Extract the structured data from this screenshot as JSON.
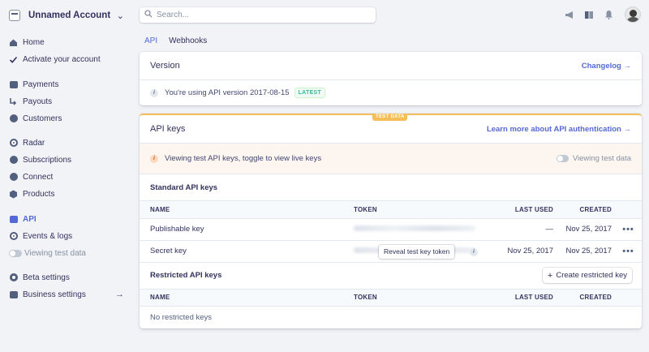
{
  "account": {
    "name": "Unnamed Account"
  },
  "search": {
    "placeholder": "Search..."
  },
  "nav": [
    {
      "label": "Home",
      "icon": "house-icon"
    },
    {
      "label": "Activate your account",
      "icon": "check-icon"
    },
    {
      "label": "Payments",
      "icon": "payments-icon"
    },
    {
      "label": "Payouts",
      "icon": "payouts-icon"
    },
    {
      "label": "Customers",
      "icon": "customers-icon"
    },
    {
      "label": "Radar",
      "icon": "radar-icon"
    },
    {
      "label": "Subscriptions",
      "icon": "subscriptions-icon"
    },
    {
      "label": "Connect",
      "icon": "connect-icon"
    },
    {
      "label": "Products",
      "icon": "products-icon"
    },
    {
      "label": "API",
      "icon": "api-icon"
    },
    {
      "label": "Events & logs",
      "icon": "events-icon"
    },
    {
      "label": "Viewing test data",
      "icon": "toggle-icon"
    },
    {
      "label": "Beta settings",
      "icon": "gear-icon"
    },
    {
      "label": "Business settings",
      "icon": "business-icon"
    }
  ],
  "tabs": [
    "API",
    "Webhooks"
  ],
  "version_card": {
    "title": "Version",
    "link": "Changelog →",
    "message": "You're using API version 2017-08-15",
    "badge": "LATEST"
  },
  "keys_card": {
    "badge": "TEST DATA",
    "title": "API keys",
    "link": "Learn more about API authentication →",
    "banner": "Viewing test API keys, toggle to view live keys",
    "toggle_label": "Viewing test data",
    "standard_title": "Standard API keys",
    "columns": [
      "NAME",
      "TOKEN",
      "LAST USED",
      "CREATED"
    ],
    "standard_rows": [
      {
        "name": "Publishable key",
        "last_used": "—",
        "created": "Nov 25, 2017"
      },
      {
        "name": "Secret key",
        "last_used": "Nov 25, 2017",
        "created": "Nov 25, 2017",
        "reveal": "Reveal test key token"
      }
    ],
    "restricted_title": "Restricted API keys",
    "create_button": "Create restricted key",
    "restricted_empty": "No restricted keys"
  },
  "colors": {
    "accent": "#5469d4",
    "test_data": "#f5be58",
    "latest": "#3ab795"
  }
}
